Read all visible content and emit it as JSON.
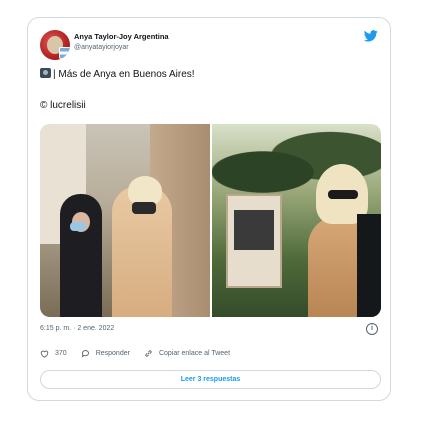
{
  "account": {
    "name": "Anya Taylor-Joy Argentina",
    "handle": "@anyatayiorjoyar"
  },
  "tweet": {
    "text": "| Más de Anya en Buenos Aires!",
    "credit": "© lucrelisii"
  },
  "meta": {
    "time": "6:15 p. m. · 2 ene. 2022"
  },
  "actions": {
    "likes": "370",
    "reply_label": "Responder",
    "copy_label": "Copiar enlace al Tweet"
  },
  "replies_button": {
    "label": "Leer 3 respuestas"
  },
  "colors": {
    "accent": "#1d9bf0",
    "secondary_text": "#536471",
    "border": "#cfd9de"
  },
  "icons": {
    "bird": "twitter-bird-icon",
    "heart": "heart-icon",
    "reply": "reply-icon",
    "link": "link-icon",
    "info": "info-icon",
    "camera": "camera-emoji-icon"
  }
}
